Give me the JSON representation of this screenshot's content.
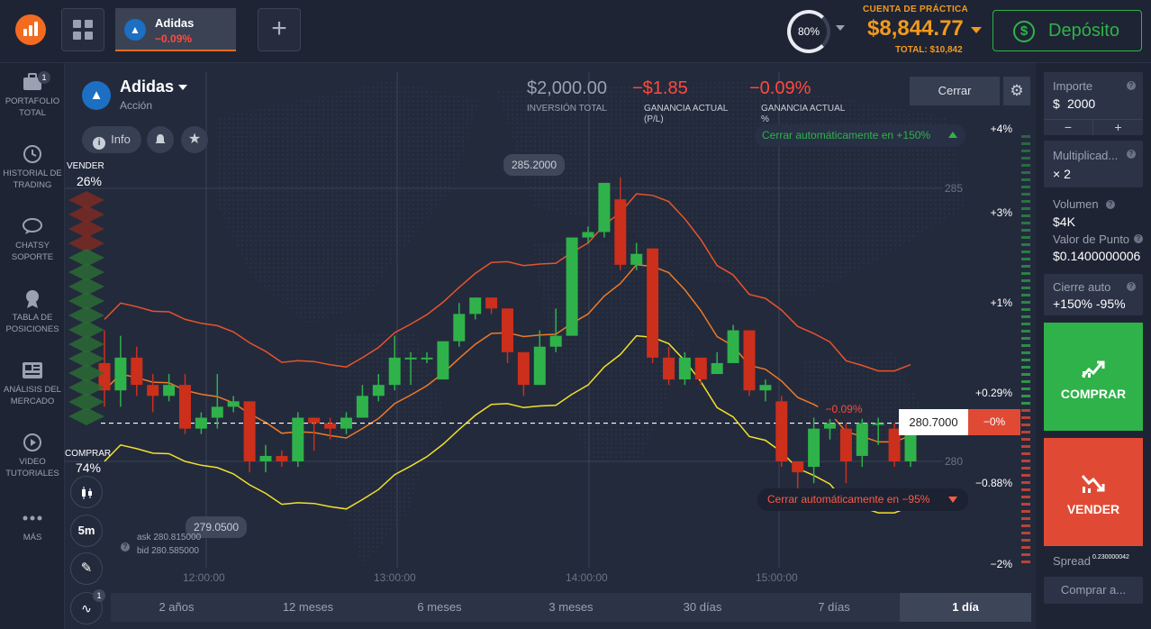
{
  "header": {
    "asset_tab": {
      "name": "Adidas",
      "change": "−0.09%"
    },
    "gauge": "80%",
    "account_label": "CUENTA DE PRÁCTICA",
    "balance": "$8,844.77",
    "total": "TOTAL: $10,842",
    "deposit_label": "Depósito"
  },
  "sidebar": {
    "items": [
      {
        "label": "PORTAFOLIO TOTAL",
        "badge": "1"
      },
      {
        "label": "HISTORIAL DE TRADING"
      },
      {
        "label": "CHATSY SOPORTE"
      },
      {
        "label": "TABLA DE POSICIONES"
      },
      {
        "label": "ANÁLISIS DEL MERCADO"
      },
      {
        "label": "VIDEO TUTORIALES"
      },
      {
        "label": "MÁS"
      }
    ]
  },
  "asset": {
    "name": "Adidas",
    "type": "Acción",
    "info_label": "Info",
    "investment_value": "$2,000.00",
    "investment_label": "INVERSIÓN TOTAL",
    "pl_value": "−$1.85",
    "pl_label": "GANANCIA ACTUAL (P/L)",
    "pct_value": "−0.09%",
    "pct_label": "GANANCIA ACTUAL %",
    "close_label": "Cerrar"
  },
  "sentiment": {
    "sell_label": "VENDER",
    "sell_pct": "26%",
    "buy_label": "COMPRAR",
    "buy_pct": "74%"
  },
  "chart_tools": {
    "interval": "5m",
    "badge": "1"
  },
  "quotes": {
    "ask": "ask 280.815000",
    "bid": "bid 280.585000"
  },
  "chart_data": {
    "type": "candlestick",
    "x_ticks": [
      "12:00:00",
      "13:00:00",
      "14:00:00",
      "15:00:00"
    ],
    "y_ticks": [
      "285",
      "280"
    ],
    "right_scale": [
      "+4%",
      "+3%",
      "+1%",
      "+0.29%",
      "−0.88%",
      "−2%"
    ],
    "high_label": "285.2000",
    "low_label": "279.0500",
    "current_price": "280.7000",
    "current_change": "−0%",
    "trade_change": "−0.09%",
    "auto_close_top": "Cerrar automáticamente en +150%",
    "auto_close_bottom": "Cerrar automáticamente en −95%",
    "candles": [
      {
        "o": 281.8,
        "c": 281.3,
        "h": 282.4,
        "l": 281.0
      },
      {
        "o": 281.3,
        "c": 281.9,
        "h": 282.3,
        "l": 281.0
      },
      {
        "o": 281.9,
        "c": 281.4,
        "h": 282.1,
        "l": 281.2
      },
      {
        "o": 281.4,
        "c": 281.2,
        "h": 281.6,
        "l": 280.9
      },
      {
        "o": 281.2,
        "c": 281.4,
        "h": 281.6,
        "l": 281.1
      },
      {
        "o": 281.4,
        "c": 280.6,
        "h": 281.6,
        "l": 280.5
      },
      {
        "o": 280.6,
        "c": 280.8,
        "h": 280.9,
        "l": 280.5
      },
      {
        "o": 280.8,
        "c": 281.0,
        "h": 281.6,
        "l": 280.6
      },
      {
        "o": 281.0,
        "c": 281.1,
        "h": 281.2,
        "l": 280.9
      },
      {
        "o": 281.1,
        "c": 280.0,
        "h": 281.1,
        "l": 279.8
      },
      {
        "o": 280.0,
        "c": 280.1,
        "h": 280.3,
        "l": 279.8
      },
      {
        "o": 280.1,
        "c": 280.0,
        "h": 280.2,
        "l": 279.9
      },
      {
        "o": 280.0,
        "c": 280.8,
        "h": 280.9,
        "l": 279.9
      },
      {
        "o": 280.8,
        "c": 280.7,
        "h": 280.8,
        "l": 280.2
      },
      {
        "o": 280.7,
        "c": 280.6,
        "h": 280.8,
        "l": 280.4
      },
      {
        "o": 280.6,
        "c": 280.8,
        "h": 280.9,
        "l": 280.5
      },
      {
        "o": 280.8,
        "c": 281.2,
        "h": 281.4,
        "l": 280.8
      },
      {
        "o": 281.2,
        "c": 281.4,
        "h": 281.6,
        "l": 281.1
      },
      {
        "o": 281.4,
        "c": 281.9,
        "h": 282.3,
        "l": 281.3
      },
      {
        "o": 281.9,
        "c": 281.9,
        "h": 282.0,
        "l": 281.4
      },
      {
        "o": 281.9,
        "c": 281.9,
        "h": 282.0,
        "l": 281.8
      },
      {
        "o": 281.5,
        "c": 282.2,
        "h": 282.2,
        "l": 281.5
      },
      {
        "o": 282.2,
        "c": 282.7,
        "h": 282.9,
        "l": 282.1
      },
      {
        "o": 282.7,
        "c": 283.0,
        "h": 283.0,
        "l": 282.6
      },
      {
        "o": 283.0,
        "c": 282.8,
        "h": 283.0,
        "l": 282.7
      },
      {
        "o": 282.8,
        "c": 282.0,
        "h": 282.8,
        "l": 281.8
      },
      {
        "o": 282.0,
        "c": 281.4,
        "h": 282.0,
        "l": 281.2
      },
      {
        "o": 281.4,
        "c": 282.1,
        "h": 282.4,
        "l": 281.4
      },
      {
        "o": 282.1,
        "c": 282.3,
        "h": 282.8,
        "l": 282.0
      },
      {
        "o": 282.3,
        "c": 284.1,
        "h": 284.1,
        "l": 282.3
      },
      {
        "o": 284.1,
        "c": 284.2,
        "h": 284.3,
        "l": 284.0
      },
      {
        "o": 284.2,
        "c": 285.1,
        "h": 285.1,
        "l": 284.1
      },
      {
        "o": 284.8,
        "c": 283.6,
        "h": 285.2,
        "l": 283.5
      },
      {
        "o": 283.6,
        "c": 283.8,
        "h": 284.0,
        "l": 283.5
      },
      {
        "o": 283.9,
        "c": 281.9,
        "h": 283.9,
        "l": 281.8
      },
      {
        "o": 281.9,
        "c": 281.5,
        "h": 282.1,
        "l": 281.4
      },
      {
        "o": 281.5,
        "c": 281.9,
        "h": 282.0,
        "l": 281.4
      },
      {
        "o": 281.9,
        "c": 281.5,
        "h": 281.9,
        "l": 281.4
      },
      {
        "o": 281.6,
        "c": 281.8,
        "h": 282.0,
        "l": 281.6
      },
      {
        "o": 281.8,
        "c": 282.4,
        "h": 282.5,
        "l": 281.8
      },
      {
        "o": 282.4,
        "c": 281.3,
        "h": 282.4,
        "l": 281.2
      },
      {
        "o": 281.3,
        "c": 281.4,
        "h": 281.5,
        "l": 281.1
      },
      {
        "o": 281.1,
        "c": 280.0,
        "h": 281.2,
        "l": 279.9
      },
      {
        "o": 280.0,
        "c": 279.8,
        "h": 280.0,
        "l": 279.5
      },
      {
        "o": 279.9,
        "c": 280.6,
        "h": 280.8,
        "l": 279.6
      },
      {
        "o": 280.6,
        "c": 280.7,
        "h": 281.1,
        "l": 280.4
      },
      {
        "o": 280.6,
        "c": 280.0,
        "h": 280.7,
        "l": 279.6
      },
      {
        "o": 280.1,
        "c": 280.7,
        "h": 281.1,
        "l": 279.9
      },
      {
        "o": 280.7,
        "c": 280.7,
        "h": 280.8,
        "l": 280.3
      },
      {
        "o": 280.6,
        "c": 280.0,
        "h": 280.7,
        "l": 279.9
      },
      {
        "o": 280.0,
        "c": 280.6,
        "h": 280.7,
        "l": 279.9
      }
    ]
  },
  "trade_box": {
    "amount_label": "Importe",
    "amount_currency": "$",
    "amount_value": "2000",
    "multiplier_label": "Multiplicad...",
    "multiplier_value": "× 2",
    "volume_label": "Volumen",
    "volume_value": "$4K",
    "point_label": "Valor de Punto",
    "point_value": "$0.1400000006",
    "autoclose_label": "Cierre auto",
    "autoclose_value": "+150%  -95%",
    "buy_label": "COMPRAR",
    "sell_label": "VENDER",
    "spread_label": "Spread",
    "spread_value": "0.230000042",
    "buy_at_label": "Comprar a..."
  },
  "timeframes": [
    "2 años",
    "12 meses",
    "6 meses",
    "3 meses",
    "30 días",
    "7 días",
    "1 día"
  ],
  "colors": {
    "up": "#2fb24a",
    "down": "#cc2f1b",
    "accent": "#f39a1c",
    "upper_band": "#e8532a",
    "mid_band": "#f07a26",
    "lower_band": "#f2e02a"
  }
}
